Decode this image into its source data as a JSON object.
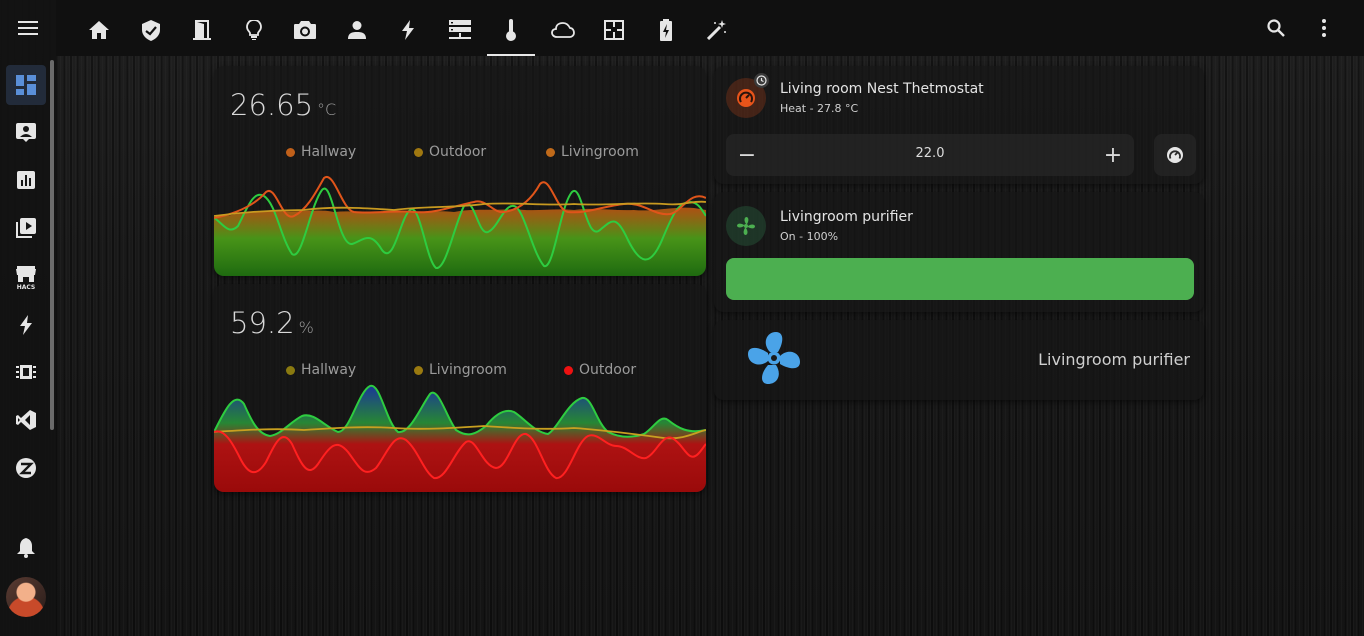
{
  "sidebar": {
    "items": [
      {
        "icon": "dashboard-icon",
        "active": true
      },
      {
        "icon": "account-box-icon",
        "active": false
      },
      {
        "icon": "chart-box-icon",
        "active": false
      },
      {
        "icon": "media-playlist-icon",
        "active": false
      },
      {
        "icon": "hacs-store-icon",
        "label": "HACS",
        "active": false
      },
      {
        "icon": "lightning-bolt-icon",
        "active": false
      },
      {
        "icon": "memory-chip-icon",
        "active": false
      },
      {
        "icon": "vscode-icon",
        "active": false
      },
      {
        "icon": "compass-icon",
        "active": false
      }
    ],
    "notifications_icon": "bell-icon",
    "avatar": "user-avatar"
  },
  "topbar": {
    "tabs": [
      "home-icon",
      "shield-check-icon",
      "door-icon",
      "lightbulb-icon",
      "camera-icon",
      "person-icon",
      "lightning-bolt-icon",
      "server-icon",
      "thermometer-icon",
      "cloud-icon",
      "floor-plan-icon",
      "battery-charging-icon",
      "magic-wand-icon"
    ],
    "active_tab": 8,
    "actions": [
      "search-icon",
      "dots-vertical-icon"
    ]
  },
  "temperature_card": {
    "value": "26.65",
    "unit": "°C",
    "legend": [
      {
        "label": "Hallway",
        "color": "#c0601a"
      },
      {
        "label": "Outdoor",
        "color": "#a07810"
      },
      {
        "label": "Livingroom",
        "color": "#c06a1a"
      }
    ]
  },
  "humidity_card": {
    "value": "59.2",
    "unit": "%",
    "legend": [
      {
        "label": "Hallway",
        "color": "#8a7a10"
      },
      {
        "label": "Livingroom",
        "color": "#9a7a10"
      },
      {
        "label": "Outdoor",
        "color": "#ee1111"
      }
    ]
  },
  "thermostat_card": {
    "title": "Living room Nest Thetmostat",
    "status": "Heat - 27.8 °C",
    "setpoint": "22.0",
    "minus": "−",
    "plus": "+",
    "accent": "#e8541a"
  },
  "purifier_card": {
    "title": "Livingroom purifier",
    "status": "On - 100%",
    "level": 1.0,
    "bar_color": "#4caf50"
  },
  "purifier_tile": {
    "name": "Livingroom purifier",
    "icon": "fan-icon",
    "icon_color": "#4aa3e8"
  }
}
